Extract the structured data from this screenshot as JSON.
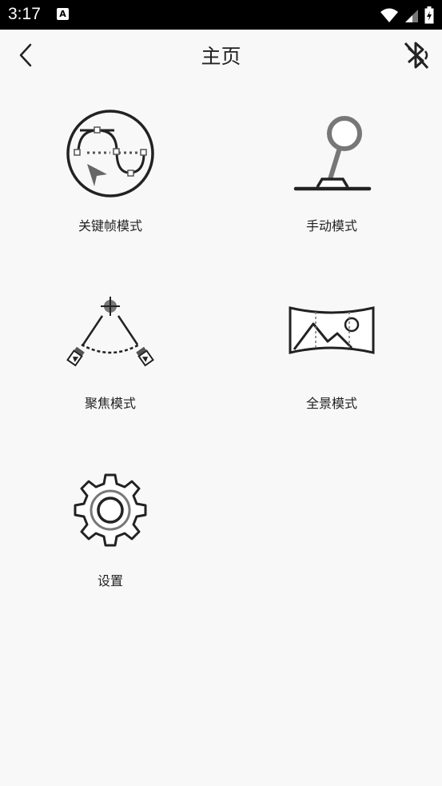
{
  "status_bar": {
    "time": "3:17",
    "notification_glyph": "A",
    "icons": [
      "wifi-icon",
      "signal-icon",
      "battery-icon"
    ]
  },
  "header": {
    "title": "主页",
    "back_icon": "chevron-left-icon",
    "bluetooth_icon": "bluetooth-disabled-icon"
  },
  "menu": {
    "items": [
      {
        "label": "关键帧模式",
        "icon": "keyframe-curve-icon"
      },
      {
        "label": "手动模式",
        "icon": "joystick-icon"
      },
      {
        "label": "聚焦模式",
        "icon": "focus-arc-icon"
      },
      {
        "label": "全景模式",
        "icon": "panorama-icon"
      },
      {
        "label": "设置",
        "icon": "gear-icon"
      }
    ]
  },
  "colors": {
    "background": "#f8f8f8",
    "status_bar": "#000000",
    "icon_dark": "#222222",
    "icon_gray": "#777777"
  }
}
